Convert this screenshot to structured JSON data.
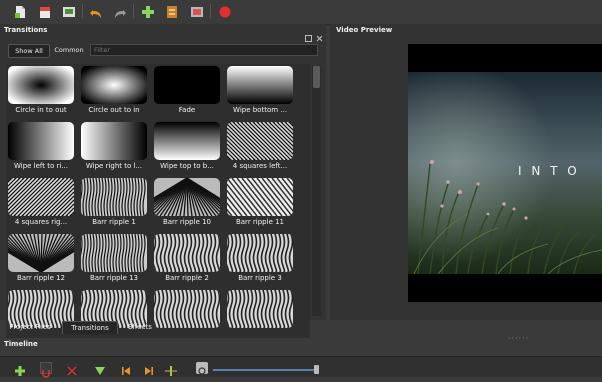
{
  "colors": {
    "accent_green": "#8bd35a",
    "record_red": "#e03030",
    "undo_orange": "#e8922a",
    "slider_blue": "#5a7fb0"
  },
  "toolbar": {
    "icons": [
      "new-project-icon",
      "open-project-icon",
      "save-project-icon",
      "undo-icon",
      "redo-icon",
      "import-files-icon",
      "profile-icon",
      "fullscreen-icon",
      "export-video-icon"
    ]
  },
  "transitions_panel": {
    "title": "Transitions",
    "filters": {
      "show_all": "Show All",
      "common": "Common",
      "placeholder": "Filter"
    },
    "items": [
      {
        "label": "Circle in to out"
      },
      {
        "label": "Circle out to in"
      },
      {
        "label": "Fade"
      },
      {
        "label": "Wipe bottom ..."
      },
      {
        "label": "Wipe left to ri..."
      },
      {
        "label": "Wipe right to l..."
      },
      {
        "label": "Wipe top to b..."
      },
      {
        "label": "4 squares left..."
      },
      {
        "label": "4 squares rig..."
      },
      {
        "label": "Barr ripple 1"
      },
      {
        "label": "Barr ripple 10"
      },
      {
        "label": "Barr ripple 11"
      },
      {
        "label": "Barr ripple 12"
      },
      {
        "label": "Barr ripple 13"
      },
      {
        "label": "Barr ripple 2"
      },
      {
        "label": "Barr ripple 3"
      },
      {
        "label": ""
      },
      {
        "label": ""
      },
      {
        "label": ""
      },
      {
        "label": ""
      }
    ]
  },
  "bottom_tabs": [
    {
      "label": "Project Files"
    },
    {
      "label": "Transitions"
    },
    {
      "label": "Effects"
    }
  ],
  "video_preview": {
    "title": "Video Preview",
    "overlay_text": "I N T O"
  },
  "timeline": {
    "title": "Timeline",
    "zoom_level": 0.95
  }
}
